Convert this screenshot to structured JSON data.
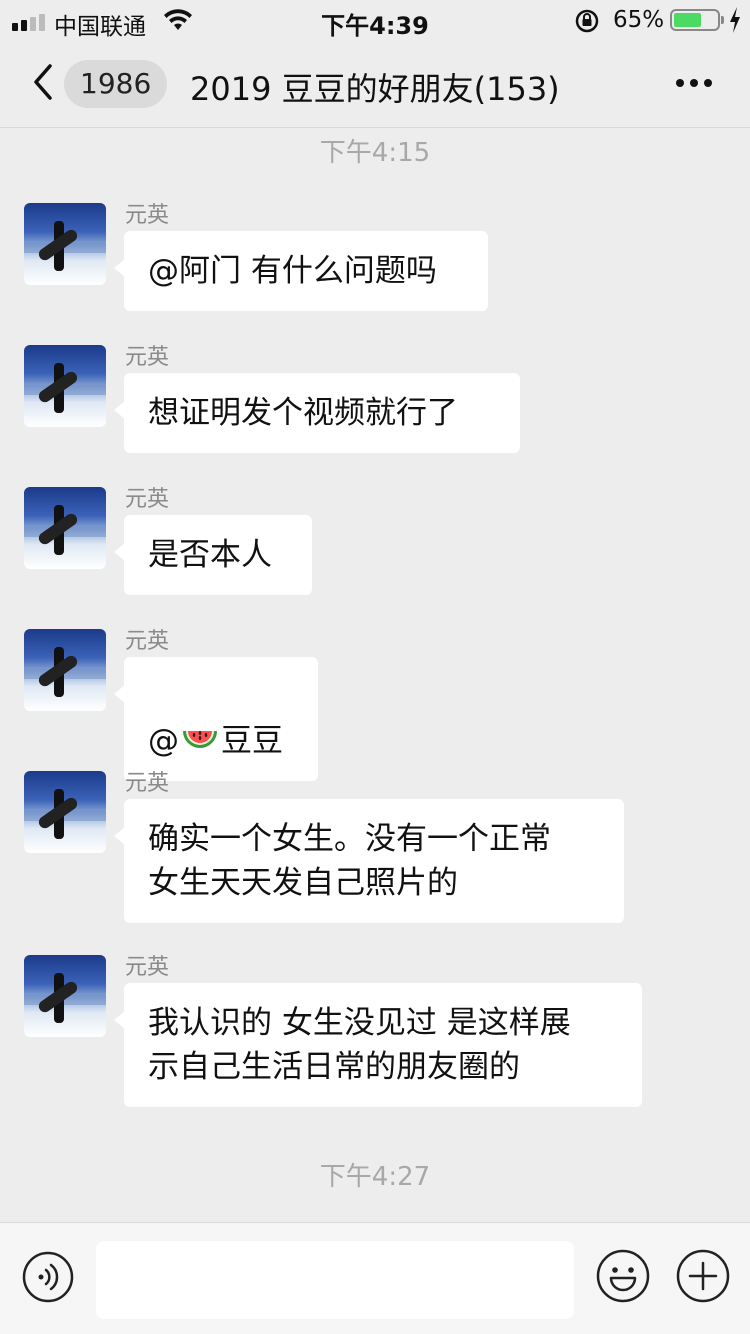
{
  "status_bar": {
    "carrier": "中国联通",
    "time": "下午4:39",
    "battery_percent": "65%",
    "battery_level": 0.65,
    "icons": [
      "signal-icon",
      "wifi-icon",
      "rotation-lock-icon",
      "battery-icon",
      "charging-icon"
    ]
  },
  "nav": {
    "unread_count": "1986",
    "title": "2019 豆豆的好朋友(153)",
    "icons": [
      "back-chevron-icon",
      "more-dots-icon"
    ]
  },
  "timestamps": [
    "下午4:15",
    "下午4:27"
  ],
  "messages": [
    {
      "sender": "元英",
      "text": "@阿门 有什么问题吗"
    },
    {
      "sender": "元英",
      "text": "想证明发个视频就行了"
    },
    {
      "sender": "元英",
      "text": "是否本人"
    },
    {
      "sender": "元英",
      "text_before": "@",
      "emoji": "watermelon-emoji",
      "text_after": "豆豆"
    },
    {
      "sender": "元英",
      "text": "确实一个女生。没有一个正常\n女生天天发自己照片的"
    },
    {
      "sender": "元英",
      "text": "我认识的 女生没见过 是这样展\n示自己生活日常的朋友圈的"
    }
  ],
  "input_bar": {
    "placeholder": "",
    "icons": [
      "voice-icon",
      "emoji-icon",
      "plus-icon"
    ]
  },
  "colors": {
    "background": "#ededed",
    "bubble": "#ffffff",
    "battery_fill": "#4cd964"
  }
}
